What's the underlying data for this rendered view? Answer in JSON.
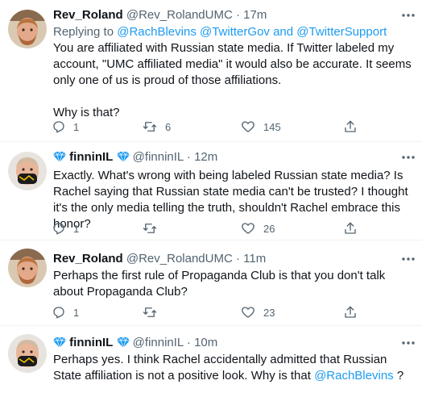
{
  "tweets": [
    {
      "name": "Rev_Roland",
      "handle": "@Rev_RolandUMC",
      "time": "17m",
      "replying_prefix": "Replying to",
      "replying_to": [
        "@RachBlevins",
        "@TwitterGov",
        "@TwitterSupport"
      ],
      "replying_and": "and",
      "text": "You are affiliated with Russian state media. If Twitter labeled my account, \"UMC affiliated media\" it would also be accurate. It seems only one of us is proud of those affiliations.\n\nWhy is that?",
      "replies": "1",
      "retweets": "6",
      "likes": "145"
    },
    {
      "name": "finninIL",
      "handle": "@finninIL",
      "time": "12m",
      "text": "Exactly. What's wrong with being labeled Russian state media? Is Rachel saying that Russian state media can't be trusted? I thought it's the only media telling the truth, shouldn't Rachel embrace this honor?",
      "replies": "1",
      "retweets": "",
      "likes": "26"
    },
    {
      "name": "Rev_Roland",
      "handle": "@Rev_RolandUMC",
      "time": "11m",
      "text": "Perhaps the first rule of Propaganda Club is that you don't talk about Propaganda Club?",
      "replies": "1",
      "retweets": "",
      "likes": "23"
    },
    {
      "name": "finninIL",
      "handle": "@finninIL",
      "time": "10m",
      "text_before": "Perhaps yes. I think Rachel accidentally admitted that Russian State affiliation is not a positive look. Why is that ",
      "mention": "@RachBlevins",
      "text_after": " ?"
    }
  ],
  "separator": "·",
  "colors": {
    "link": "#1d9bf0",
    "secondary_text": "#536471",
    "diamond": "#1d9bf0"
  }
}
